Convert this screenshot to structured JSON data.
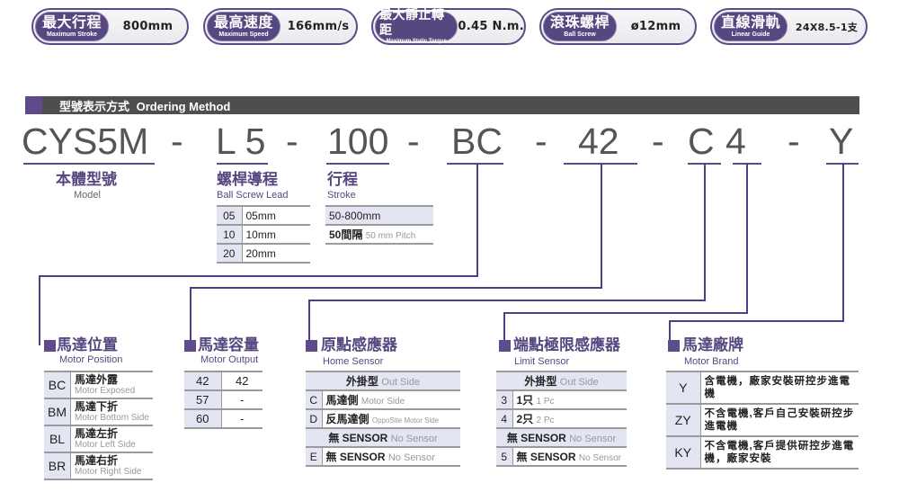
{
  "specs": [
    {
      "label_zh": "最大行程",
      "label_en": "Maximum Stroke",
      "value": "800mm"
    },
    {
      "label_zh": "最高速度",
      "label_en": "Maximum Speed",
      "value": "166mm/s"
    },
    {
      "label_zh": "最大靜止轉距",
      "label_en": "Maximum Static Torque",
      "value": "0.45 N.m."
    },
    {
      "label_zh": "滾珠螺桿",
      "label_en": "Ball Screw",
      "value": "ø12mm"
    },
    {
      "label_zh": "直線滑軌",
      "label_en": "Linear Guide",
      "value": "24X8.5-1支"
    }
  ],
  "section": {
    "title_zh": "型號表示方式",
    "title_en": "Ordering Method"
  },
  "model_code": {
    "parts": [
      "CYS5M",
      "L 5",
      "100",
      "BC",
      "42",
      "C",
      "4",
      "Y"
    ],
    "separator": "-"
  },
  "model": {
    "label_zh": "本體型號",
    "label_en": "Model"
  },
  "ball_screw_lead": {
    "label_zh": "螺桿導程",
    "label_en": "Ball Screw Lead",
    "rows": [
      {
        "code": "05",
        "value": "05mm"
      },
      {
        "code": "10",
        "value": "10mm"
      },
      {
        "code": "20",
        "value": "20mm"
      }
    ]
  },
  "stroke": {
    "label_zh": "行程",
    "label_en": "Stroke",
    "range": "50-800mm",
    "pitch_zh": "50間隔",
    "pitch_en": "50 mm Pitch"
  },
  "motor_position": {
    "label_zh": "馬達位置",
    "label_en": "Motor Position",
    "rows": [
      {
        "code": "BC",
        "zh": "馬達外露",
        "en": "Motor Exposed"
      },
      {
        "code": "BM",
        "zh": "馬達下折",
        "en": "Motor Bottom Side"
      },
      {
        "code": "BL",
        "zh": "馬達左折",
        "en": "Motor Left Side"
      },
      {
        "code": "BR",
        "zh": "馬達右折",
        "en": "Motor Right Side"
      }
    ]
  },
  "motor_output": {
    "label_zh": "馬達容量",
    "label_en": "Motor Output",
    "rows": [
      {
        "code": "42",
        "value": "42"
      },
      {
        "code": "57",
        "value": "-"
      },
      {
        "code": "60",
        "value": "-"
      }
    ]
  },
  "home_sensor": {
    "label_zh": "原點感應器",
    "label_en": "Home Sensor",
    "group1_zh": "外掛型",
    "group1_en": "Out Side",
    "rows1": [
      {
        "code": "C",
        "zh": "馬達側",
        "en": "Motor Side"
      },
      {
        "code": "D",
        "zh": "反馬達側",
        "en": "OppoSite Motor Side"
      }
    ],
    "group2_zh": "無 SENSOR",
    "group2_en": "No Sensor",
    "rows2": [
      {
        "code": "E",
        "zh": "無 SENSOR",
        "en": "No Sensor"
      }
    ]
  },
  "limit_sensor": {
    "label_zh": "端點極限感應器",
    "label_en": "Limit Sensor",
    "group1_zh": "外掛型",
    "group1_en": "Out Side",
    "rows1": [
      {
        "code": "3",
        "zh": "1只",
        "en": "1 Pc"
      },
      {
        "code": "4",
        "zh": "2只",
        "en": "2 Pc"
      }
    ],
    "group2_zh": "無 SENSOR",
    "group2_en": "No Sensor",
    "rows2": [
      {
        "code": "5",
        "zh": "無 SENSOR",
        "en": "No Sensor"
      }
    ]
  },
  "motor_brand": {
    "label_zh": "馬達廠牌",
    "label_en": "Motor Brand",
    "rows": [
      {
        "code": "Y",
        "desc": "含電機，廠家安裝研控步進電機"
      },
      {
        "code": "ZY",
        "desc": "不含電機,客戶自己安裝研控步進電機"
      },
      {
        "code": "KY",
        "desc": "不含電機,客戶提供研控步進電機，廠家安裝"
      }
    ]
  },
  "colors": {
    "accent": "#574780",
    "header_bar": "#4d4e50",
    "table_shade": "#e4e5f2"
  }
}
